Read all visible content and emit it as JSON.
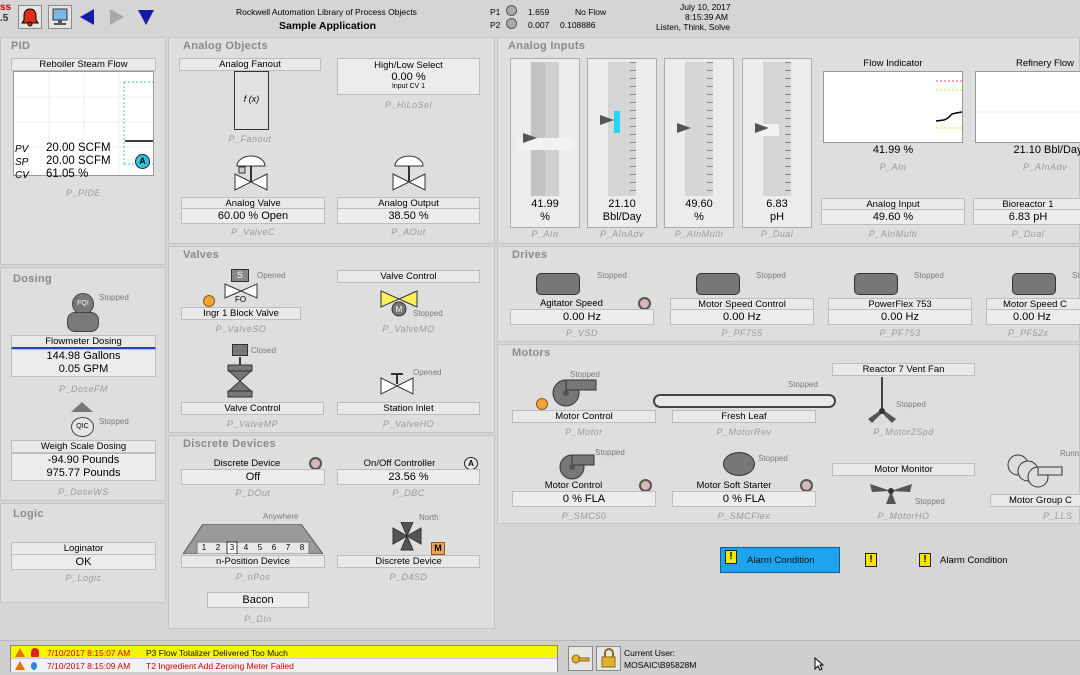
{
  "header": {
    "logo_top": "ss",
    "logo_bottom": ".5",
    "lib_title": "Rockwell Automation Library of Process Objects",
    "app_name": "Sample Application",
    "p1_label": "P1",
    "p1_value": "1.659",
    "p1_status": "No Flow",
    "p2_label": "P2",
    "p2_value": "0.007",
    "p2_value2": "0.108886",
    "date": "July 10, 2017",
    "time": "8:15:39 AM",
    "motto": "Listen, Think, Solve"
  },
  "pid": {
    "title": "PID",
    "faceplate_label": "Reboiler Steam Flow",
    "pv_label": "PV",
    "pv_value": "20.00 SCFM",
    "sp_label": "SP",
    "sp_value": "20.00 SCFM",
    "cv_label": "CV",
    "cv_value": "61.05 %",
    "mode_badge": "A",
    "tag": "P_PIDE"
  },
  "dosing": {
    "title": "Dosing",
    "flowmeter": {
      "symbol": "FQI",
      "status": "Stopped",
      "label": "Flowmeter Dosing",
      "line1": "144.98 Gallons",
      "line2": "0.05 GPM",
      "tag": "P_DoseFM"
    },
    "weigh": {
      "symbol": "QIC",
      "status": "Stopped",
      "label": "Weigh Scale Dosing",
      "line1": "-94.90 Pounds",
      "line2": "975.77 Pounds",
      "tag": "P_DoseWS"
    }
  },
  "logic": {
    "title": "Logic",
    "label": "Loginator",
    "value": "OK",
    "tag": "P_Logic"
  },
  "analog_objects": {
    "title": "Analog Objects",
    "fanout": {
      "label": "Analog Fanout",
      "symbol": "f (x)",
      "tag": "P_Fanout"
    },
    "hilo": {
      "label": "High/Low Select",
      "value": "0.00 %",
      "sub": "Input CV 1",
      "tag": "P_HiLoSel"
    },
    "valve": {
      "label": "Analog Valve",
      "value": "60.00 % Open",
      "tag": "P_ValveC"
    },
    "aout": {
      "label": "Analog Output",
      "value": "38.50 %",
      "tag": "P_AOut"
    }
  },
  "valves": {
    "title": "Valves",
    "block": {
      "status": "Opened",
      "symbol": "S",
      "fo": "FO",
      "label": "Ingr 1 Block Valve",
      "tag": "P_ValveSO"
    },
    "control": {
      "label": "Valve Control",
      "symbol": "M",
      "status": "Stopped",
      "tag": "P_ValveMO"
    },
    "mp": {
      "status": "Closed",
      "label": "Valve Control",
      "tag": "P_ValveMP"
    },
    "ho": {
      "status": "Opened",
      "label": "Station Inlet",
      "tag": "P_ValveHO"
    }
  },
  "discrete": {
    "title": "Discrete Devices",
    "dout": {
      "label": "Discrete Device",
      "value": "Off",
      "tag": "P_DOut"
    },
    "dbc": {
      "label": "On/Off Controller",
      "value": "23.56 %",
      "badge": "A",
      "tag": "P_DBC"
    },
    "npos": {
      "status": "Anywhere",
      "ticks": [
        "1",
        "2",
        "3",
        "4",
        "5",
        "6",
        "7",
        "8"
      ],
      "label": "n-Position Device",
      "tag": "P_nPos"
    },
    "d4sd": {
      "status": "North",
      "badge": "M",
      "label": "Discrete Device",
      "tag": "P_D4SD"
    },
    "din": {
      "label": "Bacon",
      "tag": "P_DIn"
    }
  },
  "analog_inputs": {
    "title": "Analog Inputs",
    "gauges": [
      {
        "value": "41.99",
        "unit": "%",
        "tag": "P_AIn"
      },
      {
        "value": "21.10",
        "unit": "Bbl/Day",
        "tag": "P_AInAdv"
      },
      {
        "value": "49.60",
        "unit": "%",
        "tag": "P_AInMulti"
      },
      {
        "value": "6.83",
        "unit": "pH",
        "tag": "P_Dual"
      }
    ],
    "trends": [
      {
        "label": "Flow Indicator",
        "value": "41.99 %",
        "tag": "P_AIn"
      },
      {
        "label": "Refinery Flow",
        "value": "21.10 Bbl/Day",
        "tag": "P_AInAdv"
      }
    ],
    "bottom": [
      {
        "label": "Analog Input",
        "value": "49.60 %",
        "tag": "P_AInMulti"
      },
      {
        "label": "Bioreactor 1",
        "value": "6.83 pH",
        "tag": "P_Dual"
      }
    ]
  },
  "drives": {
    "title": "Drives",
    "items": [
      {
        "status": "Stopped",
        "label": "Agitator Speed",
        "value": "0.00 Hz",
        "tag": "P_VSD"
      },
      {
        "status": "Stopped",
        "label": "Motor Speed Control",
        "value": "0.00 Hz",
        "tag": "P_PF755"
      },
      {
        "status": "Stopped",
        "label": "PowerFlex 753",
        "value": "0.00 Hz",
        "tag": "P_PF753"
      },
      {
        "status": "Stopped",
        "label": "Motor Speed C",
        "value": "0.00 Hz",
        "tag": "P_PF52x"
      }
    ]
  },
  "motors": {
    "title": "Motors",
    "control": {
      "status": "Stopped",
      "label": "Motor Control",
      "tag": "P_Motor"
    },
    "fresh": {
      "status": "Stopped",
      "label": "Fresh Leaf",
      "tag": "P_MotorRev"
    },
    "fan": {
      "label": "Reactor 7 Vent Fan",
      "status": "Stopped",
      "tag": "P_Motor2Spd"
    },
    "smc50": {
      "status": "Stopped",
      "label": "Motor Control",
      "value": "0 % FLA",
      "tag": "P_SMC50"
    },
    "smcflex": {
      "status": "Stopped",
      "label": "Motor Soft Starter",
      "value": "0 % FLA",
      "tag": "P_SMCFlex"
    },
    "monitor": {
      "label": "Motor Monitor",
      "status": "Stopped",
      "tag": "P_MotorHO"
    },
    "group": {
      "status": "Runn",
      "label": "Motor Group C",
      "tag": "P_LLS"
    }
  },
  "alarm_demo": {
    "selected_label": "Alarm Condition",
    "label2": "Alarm Condition",
    "mark": "!"
  },
  "alarm_banner": [
    {
      "time": "7/10/2017 8:15:07 AM",
      "text": "P3 Flow Totalizer Delivered Too Much"
    },
    {
      "time": "7/10/2017 8:15:09 AM",
      "text": "T2 Ingredient Add Zeroing Meter Failed"
    }
  ],
  "user": {
    "label": "Current User:",
    "name": "MOSAIC\\B95828M"
  }
}
